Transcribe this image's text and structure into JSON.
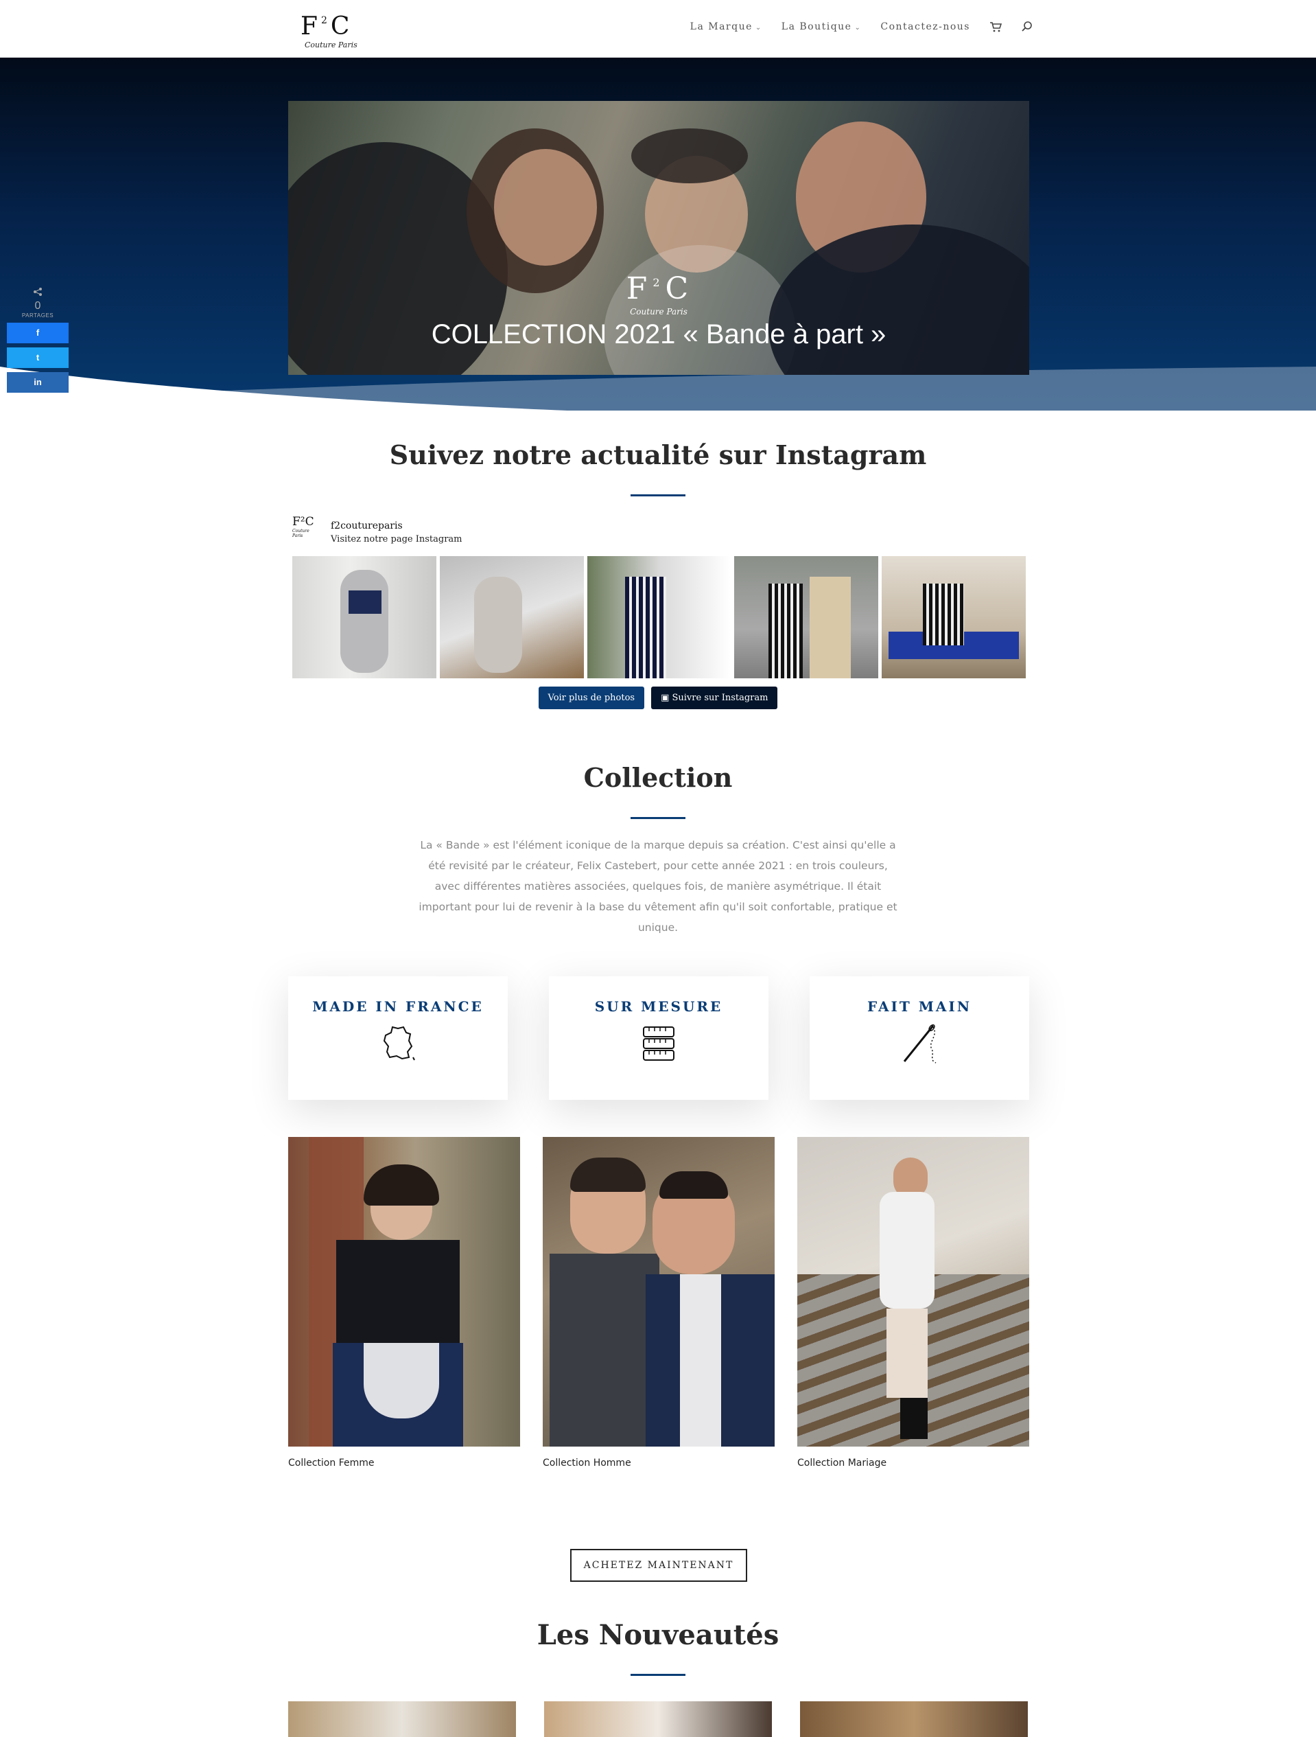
{
  "brand": {
    "logo_mark_left": "F",
    "logo_mark_sup": "2",
    "logo_mark_right": "C",
    "logo_tagline": "Couture Paris"
  },
  "nav": {
    "items": [
      {
        "label": "La Marque",
        "has_dropdown": true
      },
      {
        "label": "La Boutique",
        "has_dropdown": true
      },
      {
        "label": "Contactez-nous",
        "has_dropdown": false
      }
    ],
    "icons": [
      "cart-icon",
      "search-icon"
    ]
  },
  "hero": {
    "caption": "COLLECTION 2021 « Bande à part »",
    "logo_left": "F",
    "logo_sup": "2",
    "logo_right": "C",
    "logo_tagline": "Couture Paris"
  },
  "share": {
    "count": "0",
    "count_label": "PARTAGES",
    "buttons": [
      {
        "network": "facebook",
        "glyph": "f",
        "color": "#1877f2"
      },
      {
        "network": "twitter",
        "glyph": "t",
        "color": "#1da1f2"
      },
      {
        "network": "linkedin",
        "glyph": "in",
        "color": "#2867b2"
      }
    ]
  },
  "instagram": {
    "heading": "Suivez notre actualité sur Instagram",
    "avatar_text": "F²C",
    "avatar_tagline": "Couture Paris",
    "username": "f2coutureparis",
    "visit_text": "Visitez notre page Instagram",
    "load_more_label": "Voir plus de photos",
    "follow_label": "Suivre sur Instagram",
    "photo_count": 5
  },
  "collection": {
    "heading": "Collection",
    "description": "La « Bande » est l'élément iconique de la marque depuis sa création. C'est ainsi qu'elle a été revisité par le créateur, Felix Castebert, pour cette année 2021 : en trois couleurs, avec différentes matières associées, quelques fois, de manière asymétrique. Il était important pour lui de revenir à la base du vêtement afin qu'il soit confortable, pratique et unique."
  },
  "features": [
    {
      "title": "MADE IN FRANCE",
      "icon": "france-map-icon"
    },
    {
      "title": "SUR MESURE",
      "icon": "measuring-tape-icon"
    },
    {
      "title": "FAIT MAIN",
      "icon": "needle-thread-icon"
    }
  ],
  "collections": [
    {
      "label": "Collection Femme"
    },
    {
      "label": "Collection Homme"
    },
    {
      "label": "Collection Mariage"
    }
  ],
  "cta": {
    "label": "ACHETEZ MAINTENANT"
  },
  "nouveautes": {
    "heading": "Les Nouveautés"
  },
  "colors": {
    "accent": "#0a3d75",
    "hero_dark": "#020b19",
    "dark_button": "#04142a"
  }
}
